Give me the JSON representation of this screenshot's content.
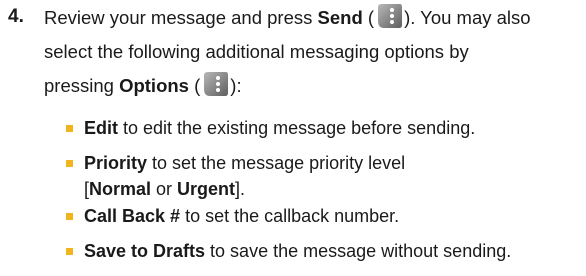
{
  "step": {
    "number": "4.",
    "line1_a": "Review your message and press ",
    "send_label": "Send",
    "line1_b": " (",
    "line1_c": "). You may also",
    "line2": "select the following additional messaging options by",
    "line3_a": "pressing ",
    "options_label": "Options",
    "line3_b": " (",
    "line3_c": "):",
    "softkey_icon": "phone-softkey-icon"
  },
  "bullets": [
    {
      "bold": "Edit",
      "text": " to edit the existing message before sending."
    },
    {
      "bold": "Priority",
      "text": " to set the message priority level"
    },
    {
      "line_a": "[",
      "bold_a": "Normal",
      "mid": " or ",
      "bold_b": "Urgent",
      "line_b": "]."
    },
    {
      "bold": "Call Back #",
      "text": " to set the callback number."
    },
    {
      "bold": "Save to Drafts",
      "text": " to save the message without sending."
    }
  ],
  "colors": {
    "bullet": "#f0b51c",
    "text": "#1a1a1a",
    "softkey_gray": "#8a8a8a"
  }
}
